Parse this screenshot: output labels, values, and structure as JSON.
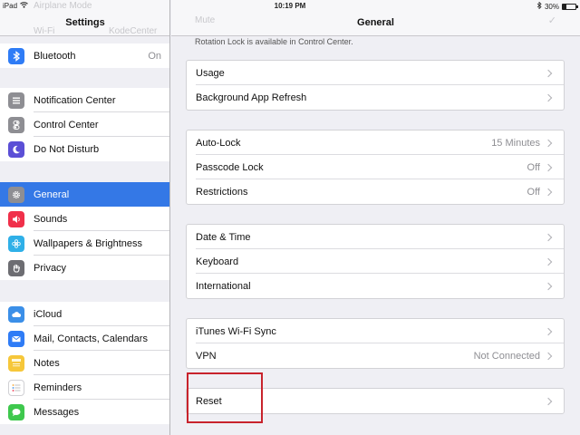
{
  "status": {
    "device": "iPad",
    "time": "10:19 PM",
    "battery": "30%",
    "battery_level": 0.3
  },
  "sidebar": {
    "title": "Settings",
    "ghost_top": "Airplane Mode",
    "ghost_wifi": "Wi-Fi",
    "ghost_wifi_value": "KodeCenter",
    "items": [
      {
        "label": "Bluetooth",
        "value": "On",
        "icon": "bluetooth-icon",
        "color": "#2f7cf6"
      },
      {
        "label": "Notification Center",
        "value": "",
        "icon": "notification-center-icon",
        "color": "#8e8e93"
      },
      {
        "label": "Control Center",
        "value": "",
        "icon": "control-center-icon",
        "color": "#8e8e93"
      },
      {
        "label": "Do Not Disturb",
        "value": "",
        "icon": "moon-icon",
        "color": "#5b4fd6"
      },
      {
        "label": "General",
        "value": "",
        "icon": "gear-icon",
        "color": "#8e8e93"
      },
      {
        "label": "Sounds",
        "value": "",
        "icon": "speaker-icon",
        "color": "#f0304a"
      },
      {
        "label": "Wallpapers & Brightness",
        "value": "",
        "icon": "flower-icon",
        "color": "#2fb0e8"
      },
      {
        "label": "Privacy",
        "value": "",
        "icon": "hand-icon",
        "color": "#6d6d72"
      },
      {
        "label": "iCloud",
        "value": "",
        "icon": "cloud-icon",
        "color": "#3b8fe8"
      },
      {
        "label": "Mail, Contacts, Calendars",
        "value": "",
        "icon": "mail-icon",
        "color": "#2f7cf6"
      },
      {
        "label": "Notes",
        "value": "",
        "icon": "notes-icon",
        "color": "#f6c73a"
      },
      {
        "label": "Reminders",
        "value": "",
        "icon": "reminders-icon",
        "color": "#ffffff"
      },
      {
        "label": "Messages",
        "value": "",
        "icon": "message-icon",
        "color": "#3ec84d"
      }
    ]
  },
  "main": {
    "title": "General",
    "ghost_mute": "Mute",
    "note": "Rotation Lock is available in Control Center.",
    "groups": [
      [
        {
          "label": "Usage",
          "value": ""
        },
        {
          "label": "Background App Refresh",
          "value": ""
        }
      ],
      [
        {
          "label": "Auto-Lock",
          "value": "15 Minutes"
        },
        {
          "label": "Passcode Lock",
          "value": "Off"
        },
        {
          "label": "Restrictions",
          "value": "Off"
        }
      ],
      [
        {
          "label": "Date & Time",
          "value": ""
        },
        {
          "label": "Keyboard",
          "value": ""
        },
        {
          "label": "International",
          "value": ""
        }
      ],
      [
        {
          "label": "iTunes Wi-Fi Sync",
          "value": ""
        },
        {
          "label": "VPN",
          "value": "Not Connected"
        }
      ],
      [
        {
          "label": "Reset",
          "value": ""
        }
      ]
    ]
  }
}
